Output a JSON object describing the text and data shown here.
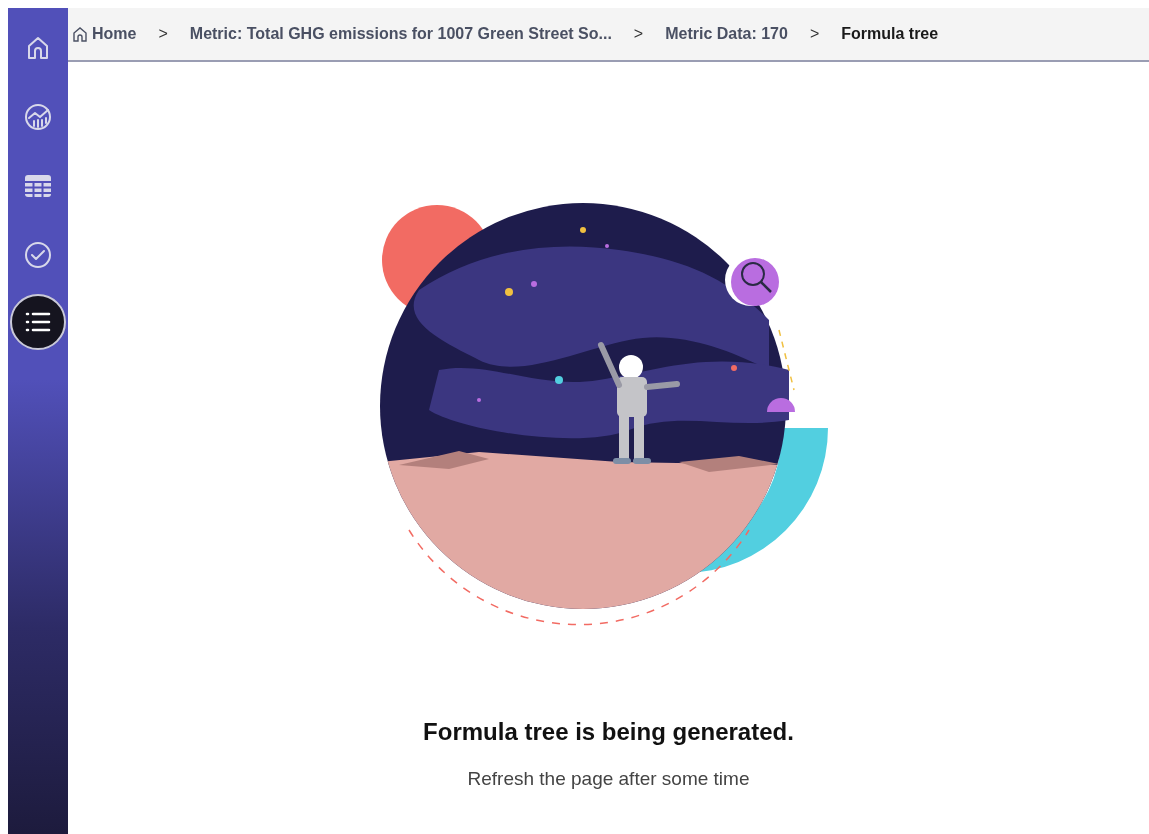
{
  "sidebar": {
    "items": [
      {
        "kind": "home",
        "selected": false
      },
      {
        "kind": "chart",
        "selected": false
      },
      {
        "kind": "table",
        "selected": false
      },
      {
        "kind": "check",
        "selected": false
      },
      {
        "kind": "list",
        "selected": true
      }
    ]
  },
  "breadcrumb": [
    {
      "label": "Home",
      "kind": "home",
      "current": false
    },
    {
      "label": "Metric: Total GHG emissions for 1007 Green Street So...",
      "kind": "link",
      "current": false
    },
    {
      "label": "Metric Data: 170",
      "kind": "link",
      "current": false
    },
    {
      "label": "Formula tree",
      "kind": "link",
      "current": true
    }
  ],
  "separator": ">",
  "message": {
    "title": "Formula tree is being generated.",
    "subtitle": "Refresh the page after some time"
  }
}
